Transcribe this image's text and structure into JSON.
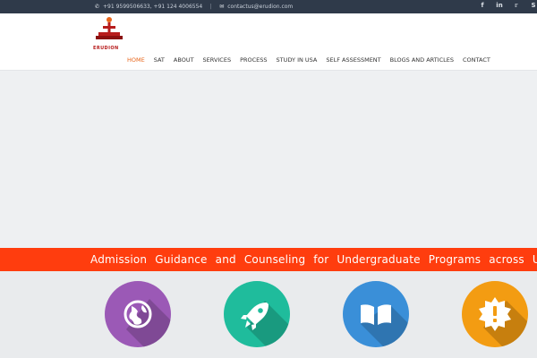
{
  "topbar": {
    "phone": "+91 9599506633, +91 124 4006554",
    "separator": "|",
    "email": "contactus@erudion.com",
    "social": [
      "facebook",
      "linkedin",
      "twitter",
      "skype"
    ]
  },
  "brand": {
    "name": "ERUDION"
  },
  "nav": {
    "items": [
      "HOME",
      "SAT",
      "ABOUT",
      "SERVICES",
      "PROCESS",
      "STUDY IN USA",
      "SELF ASSESSMENT",
      "BLOGS AND ARTICLES",
      "CONTACT"
    ],
    "active": "HOME"
  },
  "banner": {
    "text": "Admission Guidance and Counseling for Undergraduate Programs across USA"
  },
  "features": [
    {
      "icon": "globe-icon",
      "color": "#9b59b6"
    },
    {
      "icon": "rocket-icon",
      "color": "#1fbc9c"
    },
    {
      "icon": "book-icon",
      "color": "#3a8fd8"
    },
    {
      "icon": "alert-badge-icon",
      "color": "#f39c12"
    }
  ],
  "colors": {
    "topbar": "#2f3a4a",
    "accent": "#e8651a",
    "banner": "#ff3d0e"
  }
}
